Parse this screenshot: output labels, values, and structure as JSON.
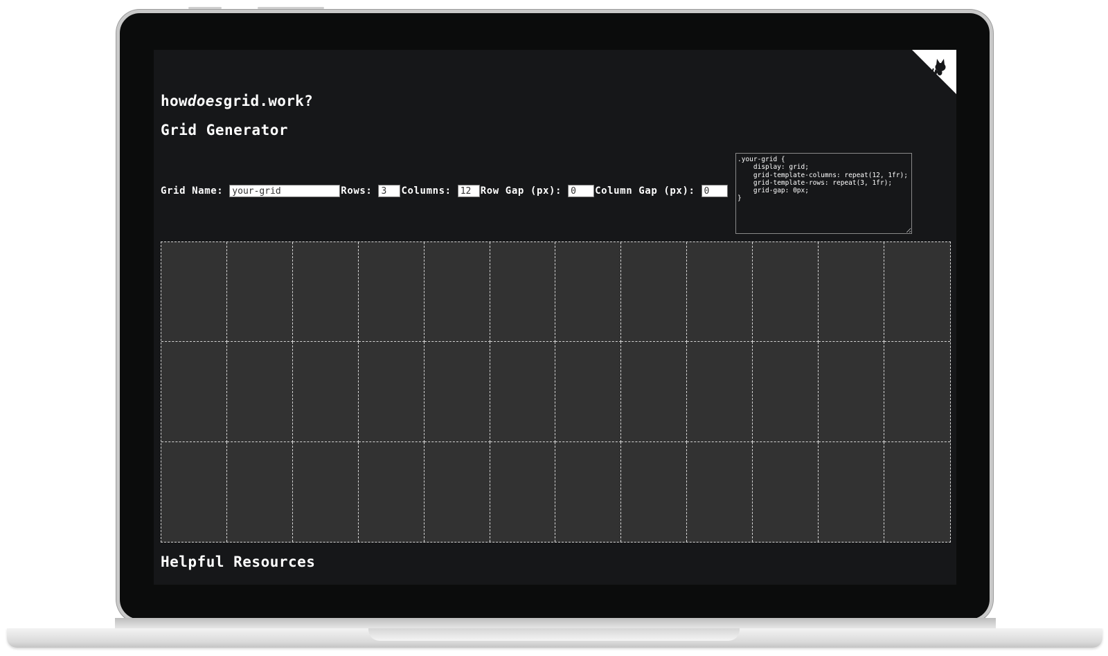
{
  "header": {
    "title_parts": [
      "how",
      "does",
      "grid.work?"
    ]
  },
  "generator": {
    "title": "Grid Generator",
    "grid_name_label": "Grid Name:",
    "grid_name_value": "your-grid",
    "rows_label": "Rows:",
    "rows_value": "3",
    "columns_label": "Columns:",
    "columns_value": "12",
    "row_gap_label": "Row Gap (px):",
    "row_gap_value": "0",
    "column_gap_label": "Column Gap (px):",
    "column_gap_value": "0",
    "css_output": ".your-grid {\n    display: grid;\n    grid-template-columns: repeat(12, 1fr);\n    grid-template-rows: repeat(3, 1fr);\n    grid-gap: 0px;\n}"
  },
  "grid_preview": {
    "rows": 3,
    "columns": 12
  },
  "resources": {
    "title": "Helpful Resources"
  },
  "icons": {
    "corner": "github-octocat-icon"
  },
  "colors": {
    "page_background": "#161719",
    "grid_cell": "#323232",
    "grid_line": "#d7d7d7",
    "text": "#ffffff"
  }
}
